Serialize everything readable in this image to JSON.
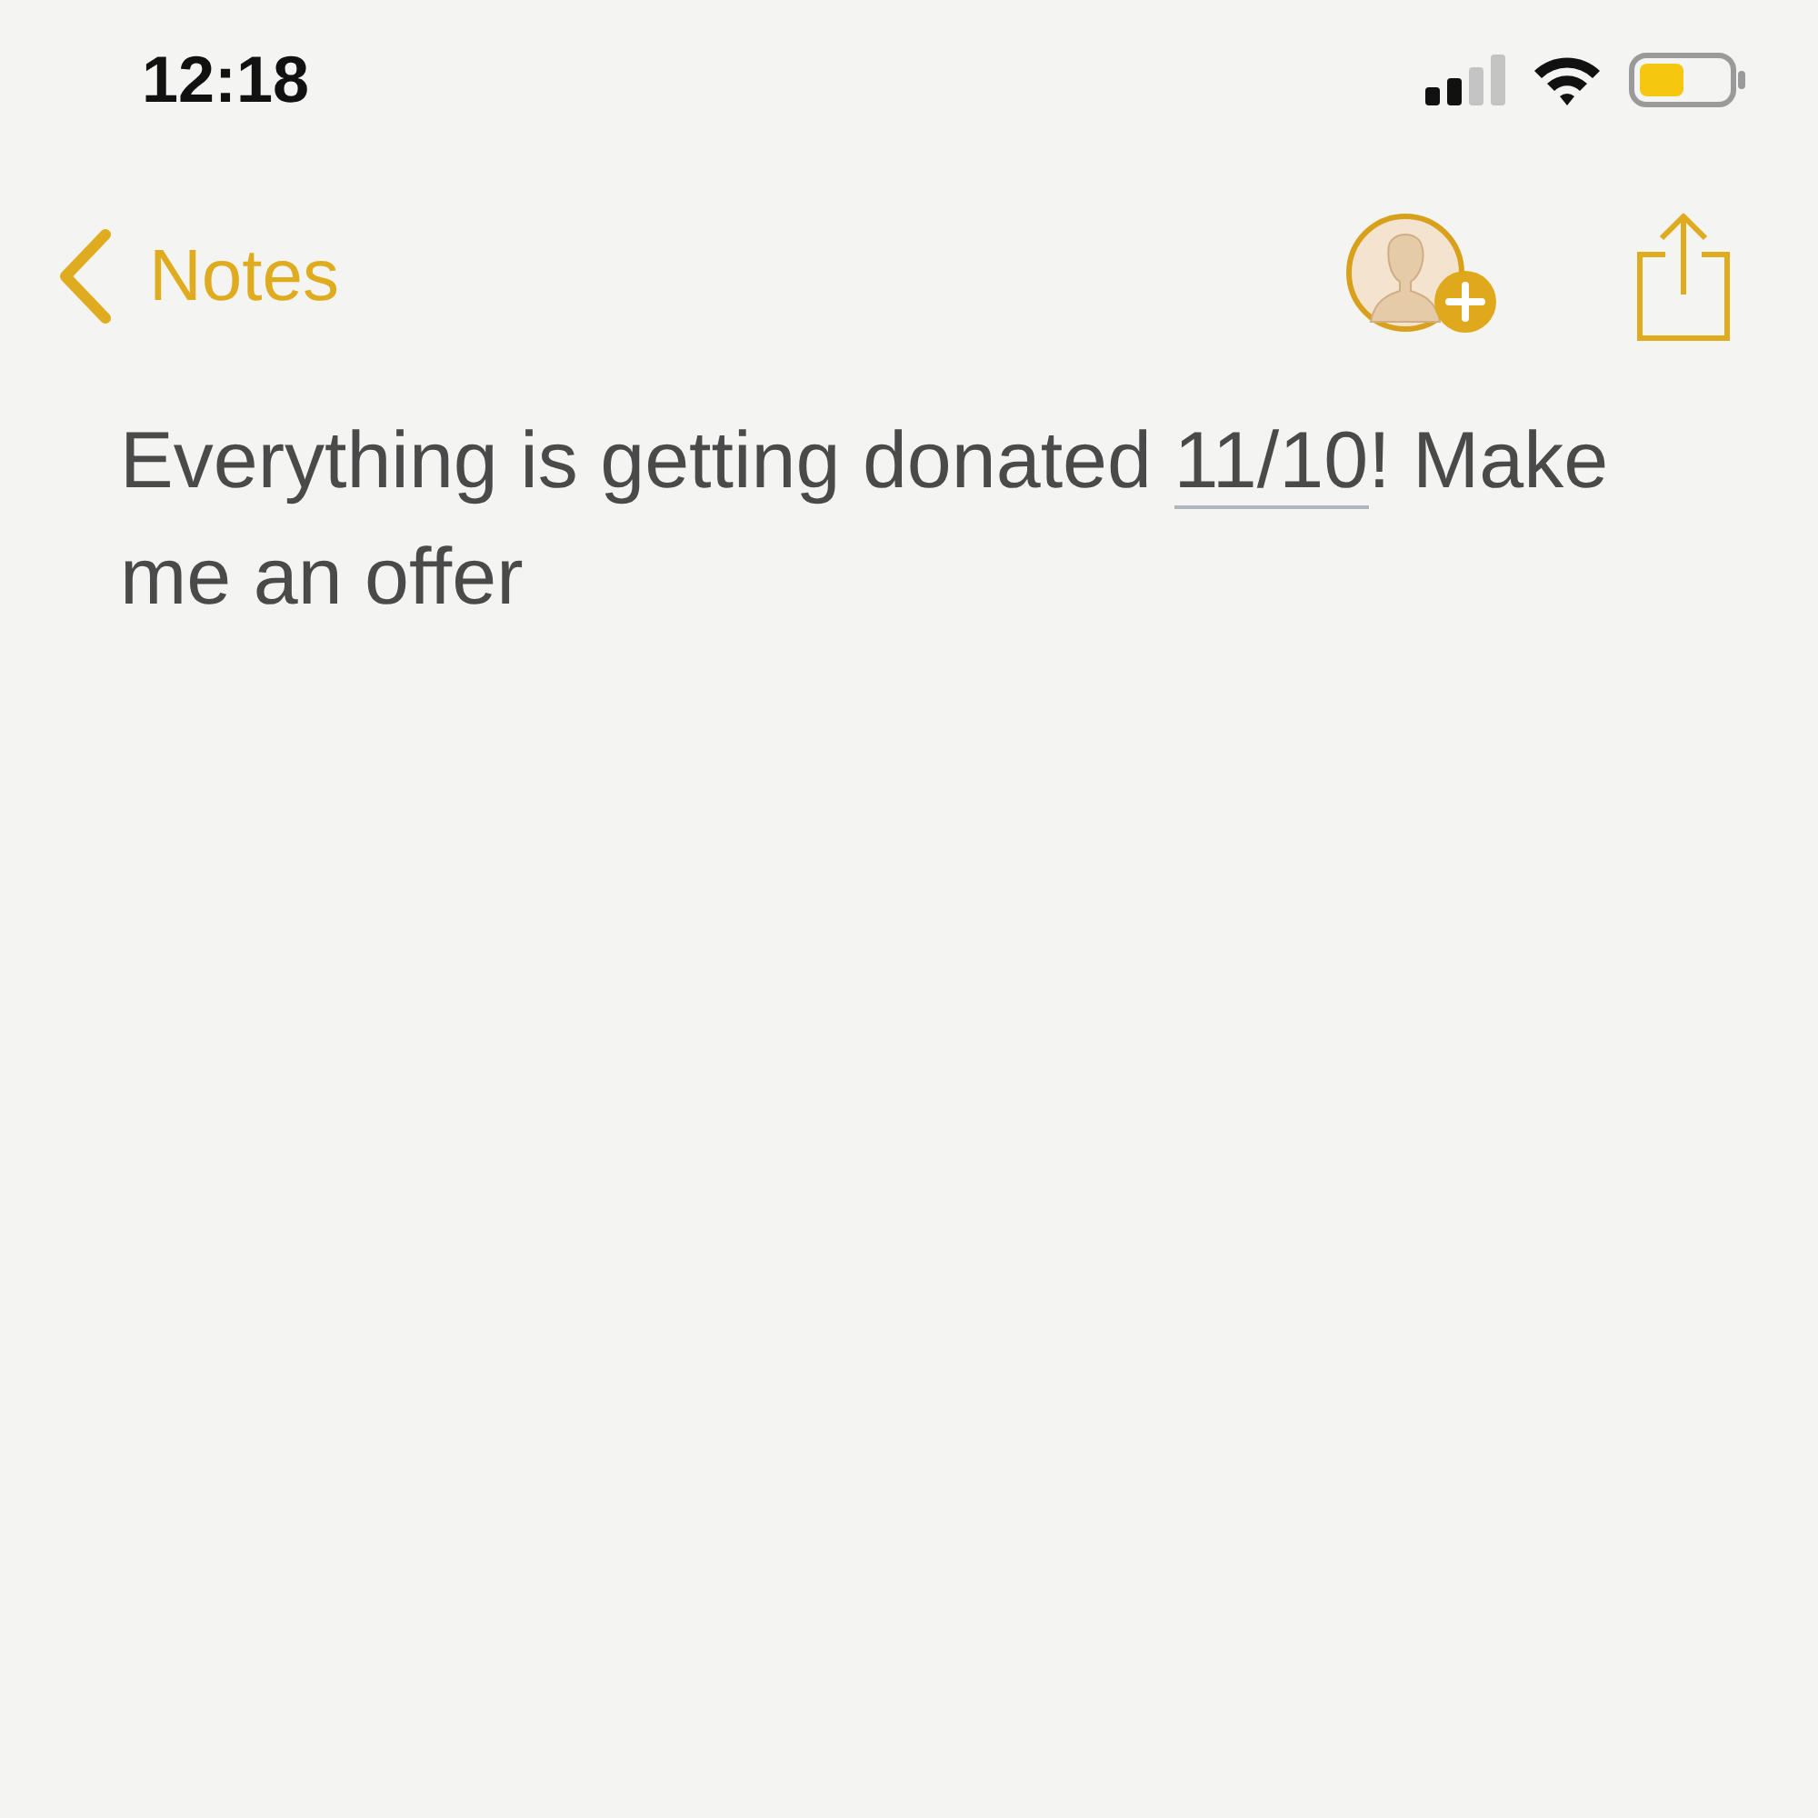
{
  "status_bar": {
    "time": "12:18"
  },
  "nav_bar": {
    "back_label": "Notes"
  },
  "note": {
    "text_before": "Everything is getting donated ",
    "date_link": "11/10",
    "text_after": "! Make me an offer"
  }
}
